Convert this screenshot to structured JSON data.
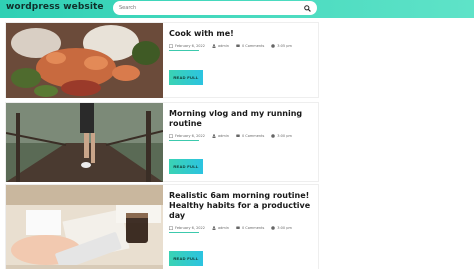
{
  "header": {
    "brand": "wordpress website",
    "search_placeholder": "Search"
  },
  "posts": [
    {
      "title": "Cook with me!",
      "date": "February 6, 2022",
      "author": "admin",
      "comments": "0 Comments",
      "time": "3:05 pm",
      "button": "READ FULL"
    },
    {
      "title": "Morning vlog and my running routine",
      "date": "February 6, 2022",
      "author": "admin",
      "comments": "0 Comments",
      "time": "3:00 pm",
      "button": "READ FULL"
    },
    {
      "title": "Realistic 6am morning routine! Healthy habits for a productive day",
      "date": "February 6, 2022",
      "author": "admin",
      "comments": "0 Comments",
      "time": "3:00 pm",
      "button": "READ FULL"
    }
  ]
}
